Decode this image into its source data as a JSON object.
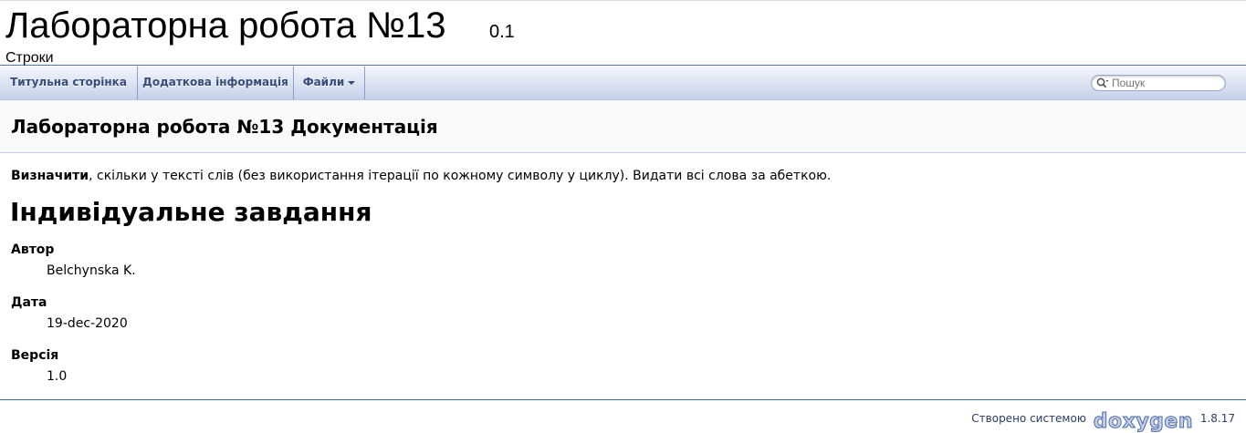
{
  "title_area": {
    "project_name": "Лабораторна робота №13",
    "project_number": "0.1",
    "project_brief": "Строки"
  },
  "navbar": {
    "items": [
      {
        "label": "Титульна сторінка"
      },
      {
        "label": "Додаткова інформація"
      },
      {
        "label": "Файли",
        "has_dropdown": true
      }
    ],
    "search": {
      "placeholder": "Пошук",
      "value": "",
      "icon": "search-icon"
    }
  },
  "header": {
    "title": "Лабораторна робота №13 Документація"
  },
  "main": {
    "intro_bold": "Визначити",
    "intro_rest": ", скільки у тексті слів (без використання ітерації по кожному символу у циклу). Видати всі слова за абеткою.",
    "section_heading": "Індивідуальне завдання",
    "fields": [
      {
        "label": "Автор",
        "value": "Belchynska K."
      },
      {
        "label": "Дата",
        "value": "19-dec-2020"
      },
      {
        "label": "Версія",
        "value": "1.0"
      }
    ]
  },
  "footer": {
    "generated_by": "Створено системою",
    "logo_text": "doxygen",
    "version": "1.8.17"
  },
  "colors": {
    "nav_text": "#364D7C",
    "header_bg": "#F9FAFC",
    "rule": "#4A6AAA"
  }
}
